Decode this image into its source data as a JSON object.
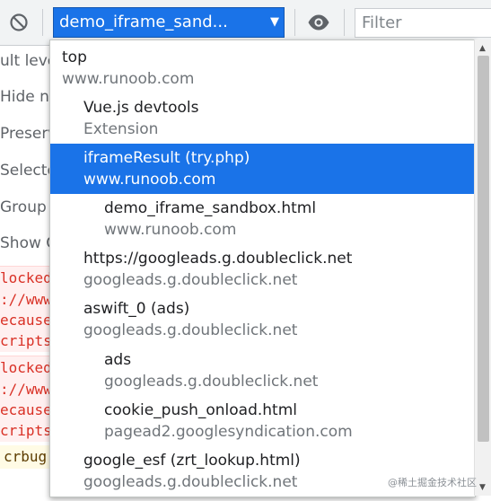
{
  "toolbar": {
    "context": "demo_iframe_sand...",
    "filter_placeholder": "Filter"
  },
  "background": {
    "sidebar_rows": [
      "ult leve",
      "Hide ne",
      "Preserve",
      "Selected",
      "Group s",
      "Show CO"
    ],
    "console_lines": [
      {
        "text": "locked",
        "kind": "error"
      },
      {
        "text": "://www",
        "kind": "error"
      },
      {
        "text": "ecause",
        "kind": "error"
      },
      {
        "text": "cripts",
        "kind": "error"
      },
      {
        "text": "locked",
        "kind": "error"
      },
      {
        "text": "://www",
        "kind": "error"
      },
      {
        "text": "ecause",
        "kind": "error"
      },
      {
        "text": "cripts",
        "kind": "error"
      },
      {
        "text": "crbug",
        "kind": "warning"
      }
    ]
  },
  "dropdown": {
    "items": [
      {
        "name": "top",
        "origin": "www.runoob.com",
        "level": 0,
        "selected": false
      },
      {
        "name": "Vue.js devtools",
        "origin": "Extension",
        "level": 1,
        "selected": false
      },
      {
        "name": "iframeResult (try.php)",
        "origin": "www.runoob.com",
        "level": 1,
        "selected": true
      },
      {
        "name": "demo_iframe_sandbox.html",
        "origin": "www.runoob.com",
        "level": 2,
        "selected": false
      },
      {
        "name": "https://googleads.g.doubleclick.net",
        "origin": "googleads.g.doubleclick.net",
        "level": 1,
        "selected": false
      },
      {
        "name": "aswift_0 (ads)",
        "origin": "googleads.g.doubleclick.net",
        "level": 1,
        "selected": false
      },
      {
        "name": "ads",
        "origin": "googleads.g.doubleclick.net",
        "level": 2,
        "selected": false
      },
      {
        "name": "cookie_push_onload.html",
        "origin": "pagead2.googlesyndication.com",
        "level": 2,
        "selected": false
      },
      {
        "name": "google_esf (zrt_lookup.html)",
        "origin": "googleads.g.doubleclick.net",
        "level": 1,
        "selected": false
      }
    ]
  },
  "watermark": "@稀土掘金技术社区",
  "colors": {
    "accent": "#1a73e8",
    "secondary_text": "#70757a",
    "error_text": "#d93025"
  }
}
